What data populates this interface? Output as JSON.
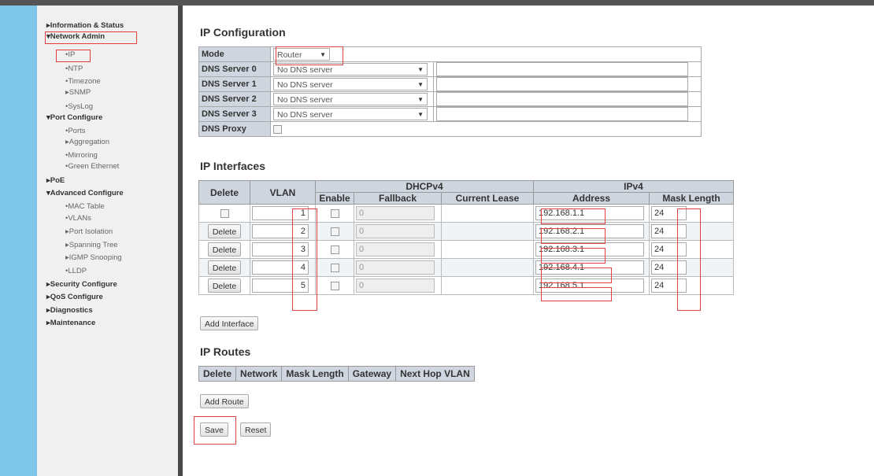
{
  "sidebar": {
    "items": [
      {
        "label": "▸Information & Status"
      },
      {
        "label": "▾Network Admin"
      },
      {
        "label": "•IP"
      },
      {
        "label": "•NTP"
      },
      {
        "label": "•Timezone"
      },
      {
        "label": "▸SNMP"
      },
      {
        "label": "•SysLog"
      },
      {
        "label": "▾Port Configure"
      },
      {
        "label": "•Ports"
      },
      {
        "label": "▸Aggregation"
      },
      {
        "label": "•Mirroring"
      },
      {
        "label": "•Green Ethernet"
      },
      {
        "label": "▸PoE"
      },
      {
        "label": "▾Advanced Configure"
      },
      {
        "label": "•MAC Table"
      },
      {
        "label": "•VLANs"
      },
      {
        "label": "▸Port Isolation"
      },
      {
        "label": "▸Spanning Tree"
      },
      {
        "label": "▸IGMP Snooping"
      },
      {
        "label": "•LLDP"
      },
      {
        "label": "▸Security Configure"
      },
      {
        "label": "▸QoS Configure"
      },
      {
        "label": "▸Diagnostics"
      },
      {
        "label": "▸Maintenance"
      }
    ]
  },
  "ip_config": {
    "title": "IP Configuration",
    "mode_label": "Mode",
    "mode_value": "Router",
    "dns": [
      {
        "label": "DNS Server 0",
        "value": "No DNS server"
      },
      {
        "label": "DNS Server 1",
        "value": "No DNS server"
      },
      {
        "label": "DNS Server 2",
        "value": "No DNS server"
      },
      {
        "label": "DNS Server 3",
        "value": "No DNS server"
      }
    ],
    "dns_proxy_label": "DNS Proxy"
  },
  "ip_interfaces": {
    "title": "IP Interfaces",
    "headers": {
      "delete": "Delete",
      "vlan": "VLAN",
      "dhcpv4": "DHCPv4",
      "ipv4": "IPv4",
      "enable": "Enable",
      "fallback": "Fallback",
      "current_lease": "Current Lease",
      "address": "Address",
      "mask_length": "Mask Length"
    },
    "delete_label": "Delete",
    "rows": [
      {
        "vlan": "1",
        "fallback": "0",
        "address": "192.168.1.1",
        "mask": "24"
      },
      {
        "vlan": "2",
        "fallback": "0",
        "address": "192.168.2.1",
        "mask": "24"
      },
      {
        "vlan": "3",
        "fallback": "0",
        "address": "192.168.3.1",
        "mask": "24"
      },
      {
        "vlan": "4",
        "fallback": "0",
        "address": "192.168.4.1",
        "mask": "24"
      },
      {
        "vlan": "5",
        "fallback": "0",
        "address": "192.168.5.1",
        "mask": "24"
      }
    ],
    "add_interface_label": "Add Interface"
  },
  "ip_routes": {
    "title": "IP Routes",
    "headers": [
      "Delete",
      "Network",
      "Mask Length",
      "Gateway",
      "Next Hop VLAN"
    ],
    "add_route_label": "Add Route"
  },
  "actions": {
    "save_label": "Save",
    "reset_label": "Reset"
  },
  "colors": {
    "highlight": "#e04040",
    "header_bg": "#cfd6e0",
    "sidebar_accent": "#7fc7e8"
  }
}
